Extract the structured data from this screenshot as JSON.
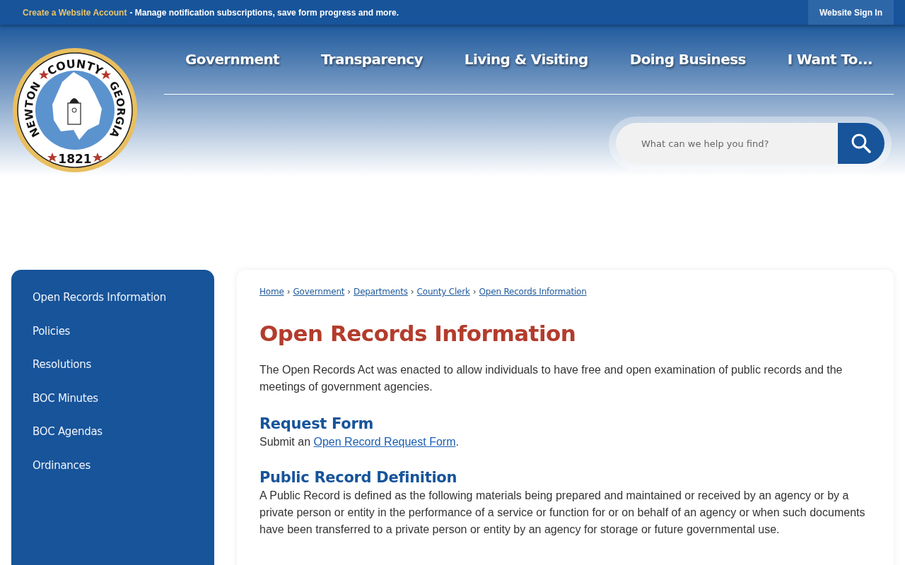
{
  "top_bar": {
    "account_link": "Create a Website Account",
    "account_text": "- Manage notification subscriptions, save form progress and more.",
    "sign_in": "Website Sign In"
  },
  "logo": {
    "top_words": "COUNTY",
    "left_words": "NEWTON",
    "right_words": "GEORGIA",
    "year": "1821"
  },
  "nav": [
    "Government",
    "Transparency",
    "Living & Visiting",
    "Doing Business",
    "I Want To..."
  ],
  "search": {
    "placeholder": "What can we help you find?"
  },
  "sidebar": {
    "items": [
      {
        "label": "Open Records Information"
      },
      {
        "label": "Policies"
      },
      {
        "label": "Resolutions"
      },
      {
        "label": "BOC Minutes"
      },
      {
        "label": "BOC Agendas"
      },
      {
        "label": "Ordinances"
      }
    ]
  },
  "breadcrumb": {
    "separator": "›",
    "items": [
      "Home",
      "Government",
      "Departments",
      "County Clerk",
      "Open Records Information"
    ]
  },
  "title": "Open Records Information",
  "intro": "The Open Records Act was enacted to allow individuals to have free and open examination of public records and the meetings of government agencies.",
  "sections": [
    {
      "heading": "Request Form",
      "before": "Submit an ",
      "link": "Open Record Request Form",
      "after": "."
    },
    {
      "heading": "Public Record Definition",
      "text": "A Public Record is defined as the following materials being prepared and maintained or received by an agency or by a private person or entity in the performance of a service or function for or on behalf of an agency or when such documents have been transferred to a private person or entity by an agency for storage or future governmental use."
    }
  ]
}
